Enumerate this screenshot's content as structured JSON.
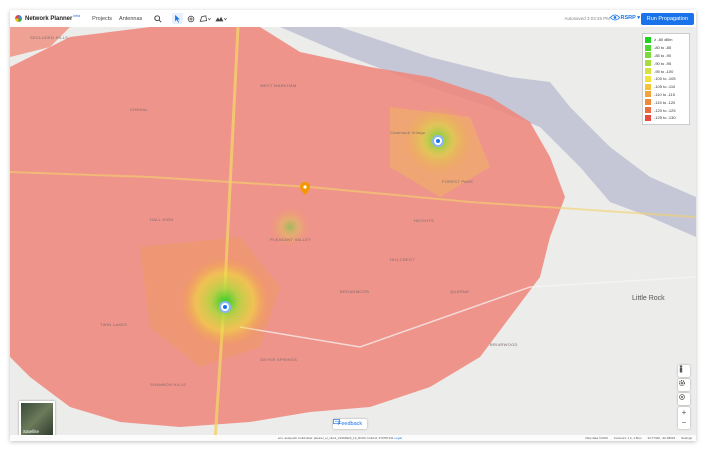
{
  "app": {
    "title": "Network Planner",
    "badge": "beta"
  },
  "nav": {
    "projects": "Projects",
    "antennas": "Antennas"
  },
  "status": {
    "autosave": "Autosaved 3:03:45 PM"
  },
  "metric_select": {
    "value": "RSRP"
  },
  "actions": {
    "run": "Run Propagation"
  },
  "legend": {
    "items": [
      {
        "label": "≥ -80 dBm",
        "color": "#1fd21f"
      },
      {
        "label": "-80 to -85",
        "color": "#4ed830"
      },
      {
        "label": "-85 to -90",
        "color": "#7bdb3a"
      },
      {
        "label": "-90 to -95",
        "color": "#a7dd3c"
      },
      {
        "label": "-95 to -100",
        "color": "#d4e23d"
      },
      {
        "label": "-100 to -105",
        "color": "#f2e23b"
      },
      {
        "label": "-105 to -110",
        "color": "#f5c338"
      },
      {
        "label": "-110 to -115",
        "color": "#f2a43a"
      },
      {
        "label": "-115 to -120",
        "color": "#ef8a3c"
      },
      {
        "label": "-120 to -125",
        "color": "#ec6d3e"
      },
      {
        "label": "-125 to -130",
        "color": "#e84c3d"
      }
    ]
  },
  "map": {
    "labels": {
      "secluded_hills": "SECLUDED HILLS",
      "little_rock": "Little Rock",
      "cammack": "Cammack Village",
      "heights": "HEIGHTS",
      "forest_park": "FOREST PARK",
      "pleasant_valley": "PLEASANT VALLEY",
      "hillcrest": "HILLCREST",
      "quapaw": "QUAPAW",
      "briarwood": "BRIARWOOD",
      "shannon_hills": "SHANNON HILLS",
      "twin_lakes": "TWIN LAKES",
      "broadmoor": "BROADMOOR",
      "geyer_springs": "GEYER SPRINGS",
      "hall_high": "HALL HIGH",
      "chenal": "CHENAL",
      "west_markham": "WEST MARKHAM"
    },
    "satellite_label": "Satellite",
    "feedback_label": "Feedback",
    "build_info": "env: autopush, build label: planner_ui_client_20190923_13_RC00, build id: 270787141",
    "build_link": "Legal",
    "map_data": "Map data ©2019",
    "scale": "Contours: 1 k, 1.6km",
    "coords": "34.77346, -92.38633",
    "settings": "Settings"
  },
  "colors": {
    "accent": "#1a73e8"
  }
}
